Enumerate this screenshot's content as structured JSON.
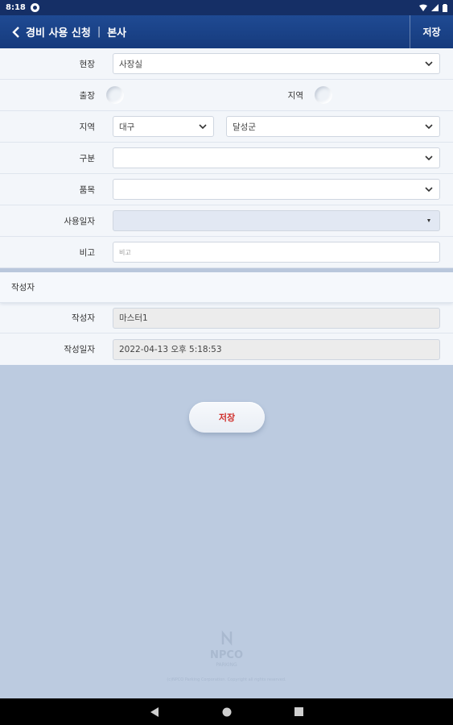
{
  "status_bar": {
    "time": "8:18"
  },
  "app_bar": {
    "title": "경비 사용 신청",
    "separator": "|",
    "subtitle": "본사",
    "save_label": "저장"
  },
  "form": {
    "site": {
      "label": "현장",
      "value": "사장실"
    },
    "trip": {
      "label": "출장"
    },
    "region_radio": {
      "label": "지역"
    },
    "region": {
      "label": "지역",
      "value1": "대구",
      "value2": "달성군"
    },
    "category": {
      "label": "구분",
      "value": ""
    },
    "item": {
      "label": "품목",
      "value": ""
    },
    "use_date": {
      "label": "사용일자",
      "value": ""
    },
    "note": {
      "label": "비고",
      "placeholder": "비고"
    }
  },
  "author_section": {
    "heading": "작성자",
    "author": {
      "label": "작성자",
      "value": "마스터1"
    },
    "created": {
      "label": "작성일자",
      "value": "2022-04-13 오후 5:18:53"
    }
  },
  "save_button": {
    "label": "저장"
  },
  "watermark": {
    "logo": "NPCO",
    "sub": "PARKING",
    "copyright": "(c)NPCO Parking Corporation. Copyright all rights reserved."
  },
  "colors": {
    "header": "#163b7d",
    "accent": "#d0312d",
    "background": "#bccbe0"
  }
}
